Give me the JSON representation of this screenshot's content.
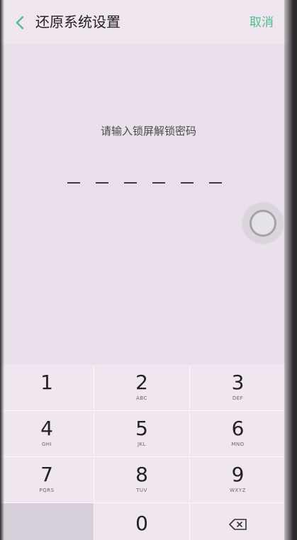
{
  "header": {
    "title": "还原系统设置",
    "cancel_label": "取消"
  },
  "prompt": "请输入锁屏解锁密码",
  "passcode_length": 6,
  "keypad": {
    "keys": [
      {
        "digit": "1"
      },
      {
        "digit": "2",
        "letters": "ABC"
      },
      {
        "digit": "3",
        "letters": "DEF"
      },
      {
        "digit": "4",
        "letters": "GHI"
      },
      {
        "digit": "5",
        "letters": "JKL"
      },
      {
        "digit": "6",
        "letters": "MNO"
      },
      {
        "digit": "7",
        "letters": "PQRS"
      },
      {
        "digit": "8",
        "letters": "TUV"
      },
      {
        "digit": "9",
        "letters": "WXYZ"
      },
      {},
      {
        "digit": "0"
      },
      {
        "icon": "backspace-icon"
      }
    ]
  },
  "icons": {
    "back": "chevron-left-icon",
    "delete": "backspace-icon",
    "assistive": "assistive-touch-icon"
  },
  "colors": {
    "accent": "#4dbf8e",
    "background": "#e9e0eb",
    "keypad": "#efe6ef",
    "text": "#222222"
  }
}
